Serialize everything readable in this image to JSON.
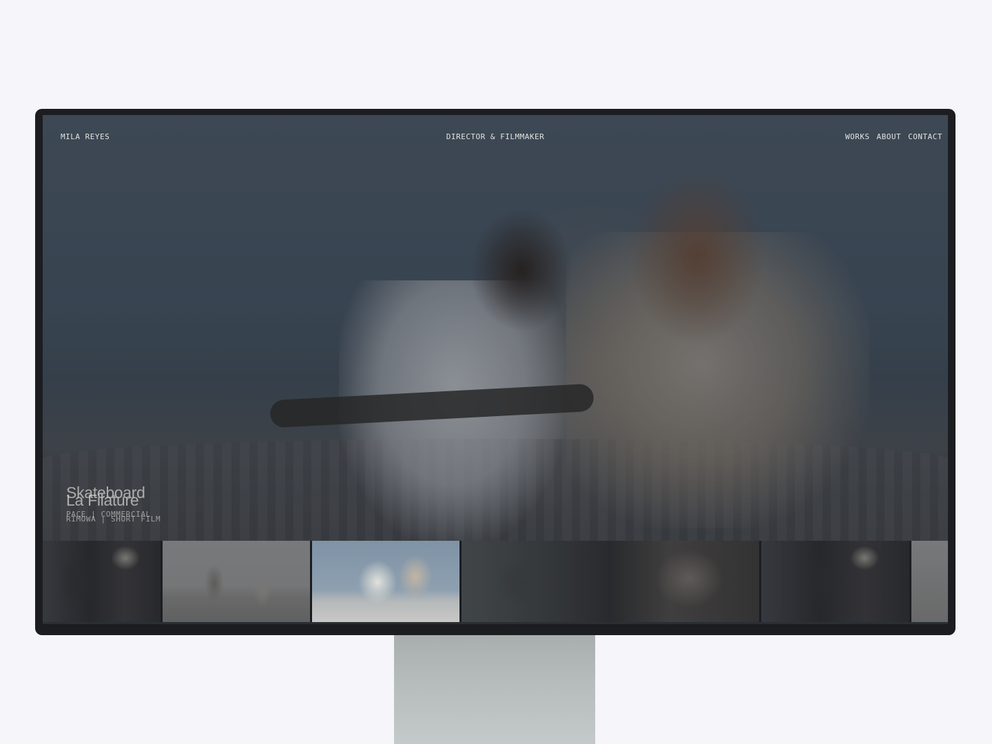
{
  "header": {
    "brand": "MILA REYES",
    "tagline": "DIRECTOR & FILMMAKER",
    "nav": [
      {
        "label": "WORKS"
      },
      {
        "label": "ABOUT"
      },
      {
        "label": "CONTACT"
      }
    ]
  },
  "featured": {
    "outgoing": {
      "title": "Skateboard",
      "meta": "PACE | COMMERCIAL"
    },
    "incoming": {
      "title": "La Filature",
      "meta": "RIMOWA | SHORT FILM"
    }
  },
  "thumbnails": [
    {
      "name": "portrait-man-reading"
    },
    {
      "name": "figures-in-field"
    },
    {
      "name": "skateboard-duo",
      "active": true
    },
    {
      "name": "car-and-typewriter"
    },
    {
      "name": "portrait-man-reading-repeat"
    },
    {
      "name": "field-partial"
    }
  ]
}
